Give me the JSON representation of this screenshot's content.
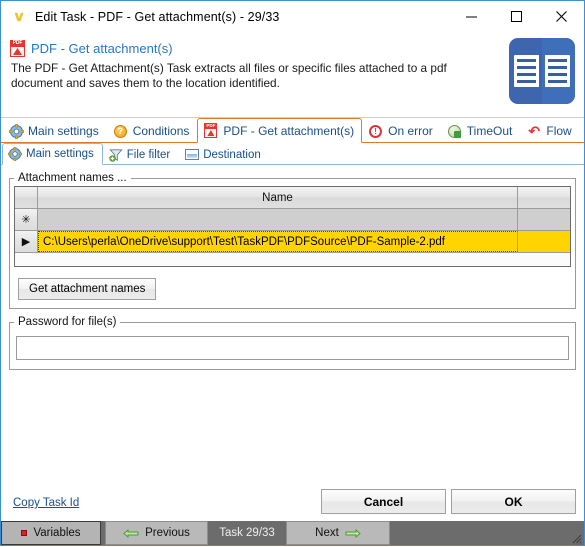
{
  "window": {
    "title": "Edit Task - PDF - Get attachment(s) - 29/33",
    "app_icon": "v-logo-icon",
    "minimize_label": "minimize-icon",
    "maximize_label": "maximize-icon",
    "close_label": "close-icon"
  },
  "header": {
    "icon": "pdf-icon",
    "title": "PDF - Get attachment(s)",
    "description": "The PDF - Get Attachment(s) Task extracts all files or specific files attached to a pdf document and saves them to the location identified.",
    "badge_icon": "open-book-icon"
  },
  "tabs": [
    {
      "label": "Main settings",
      "icon": "gear-icon",
      "selected": false
    },
    {
      "label": "Conditions",
      "icon": "question-icon",
      "selected": false
    },
    {
      "label": "PDF - Get attachment(s)",
      "icon": "pdf-icon",
      "selected": true
    },
    {
      "label": "On error",
      "icon": "error-icon",
      "selected": false
    },
    {
      "label": "TimeOut",
      "icon": "timeout-icon",
      "selected": false
    },
    {
      "label": "Flow",
      "icon": "flow-icon",
      "selected": false
    }
  ],
  "subtabs": [
    {
      "label": "Main settings",
      "icon": "gear-icon",
      "selected": true
    },
    {
      "label": "File filter",
      "icon": "funnel-icon",
      "selected": false
    },
    {
      "label": "Destination",
      "icon": "destination-icon",
      "selected": false
    }
  ],
  "attachment_group": {
    "legend": "Attachment names ...",
    "columns": [
      "Name",
      ""
    ],
    "new_row_marker": "✳",
    "current_row_marker": "▶",
    "rows": [
      {
        "name": "C:\\Users\\perla\\OneDrive\\support\\Test\\TaskPDF\\PDFSource\\PDF-Sample-2.pdf",
        "selected": true
      }
    ],
    "get_button": "Get attachment names"
  },
  "password_group": {
    "legend": "Password for file(s)",
    "value": "",
    "placeholder": ""
  },
  "footer": {
    "copy_task_id": "Copy Task Id",
    "cancel": "Cancel",
    "ok": "OK"
  },
  "statusbar": {
    "variables": "Variables",
    "previous": "Previous",
    "task_counter": "Task 29/33",
    "next": "Next",
    "prev_icon": "arrow-left-icon",
    "next_icon": "arrow-right-icon",
    "variables_icon": "red-square-icon",
    "grip_icon": "resize-grip-icon"
  },
  "colors": {
    "window_border": "#3b8fd4",
    "tab_border": "#e07a2a",
    "link": "#1a4f8a",
    "selected_row": "#ffd400",
    "badge_blue": "#3d66ae",
    "statusbar": "#6c6c6c"
  }
}
